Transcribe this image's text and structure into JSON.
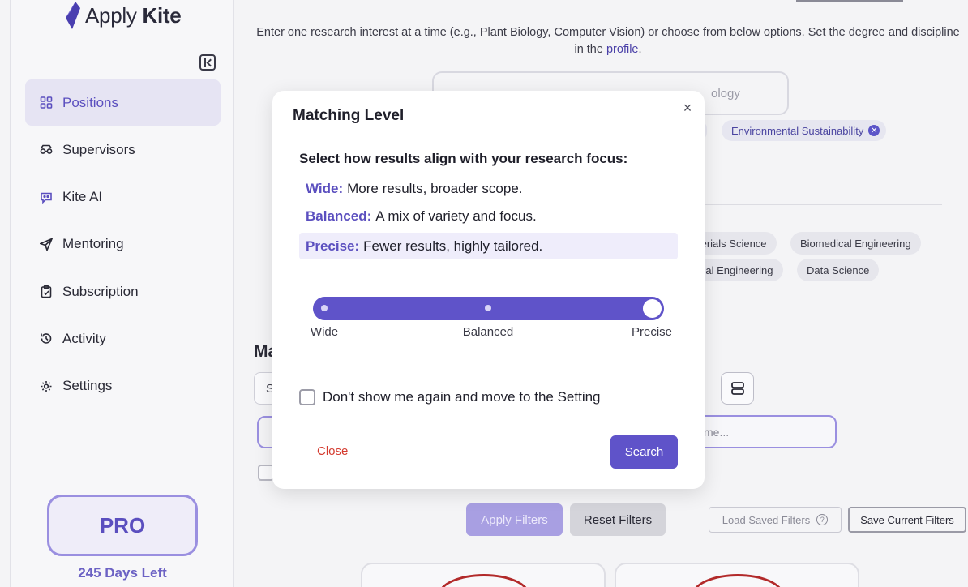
{
  "app": {
    "logo_light": "Apply",
    "logo_bold": "Kite",
    "accent_color": "#5f53c9"
  },
  "sidebar": {
    "items": [
      {
        "label": "Positions",
        "icon": "grid-icon",
        "active": true
      },
      {
        "label": "Supervisors",
        "icon": "glasses-icon",
        "active": false
      },
      {
        "label": "Kite AI",
        "icon": "chat-bot-icon",
        "active": false
      },
      {
        "label": "Mentoring",
        "icon": "send-icon",
        "active": false
      },
      {
        "label": "Subscription",
        "icon": "clipboard-icon",
        "active": false
      },
      {
        "label": "Activity",
        "icon": "history-icon",
        "active": false
      },
      {
        "label": "Settings",
        "icon": "gear-icon",
        "active": false
      }
    ],
    "plan": "PRO",
    "days_left": "245 Days Left"
  },
  "main": {
    "intro_text": "Enter one research interest at a time (e.g., Plant Biology, Computer Vision) or choose from below options. Set the degree and discipline in the",
    "intro_link": "profile",
    "intro_end": ".",
    "search_placeholder_visible": "ology",
    "selected_chips": [
      "Environmental Sustainability"
    ],
    "suggested_tags": [
      "terials Science",
      "Biomedical Engineering",
      "ical Engineering",
      "Data Science"
    ],
    "section_title_visible": "Ma",
    "select_visible": "S",
    "name_input_placeholder_visible": "me...",
    "apply_filters": "Apply Filters",
    "reset_filters": "Reset Filters",
    "load_saved_filters": "Load Saved Filters",
    "help_glyph": "?",
    "save_current_filters": "Save Current Filters"
  },
  "modal": {
    "title": "Matching Level",
    "close_glyph": "×",
    "subtitle": "Select how results align with your research focus:",
    "options": [
      {
        "key": "Wide:",
        "desc": "More results, broader scope.",
        "selected": false
      },
      {
        "key": "Balanced:",
        "desc": "A mix of variety and focus.",
        "selected": false
      },
      {
        "key": "Precise:",
        "desc": "Fewer results, highly tailored.",
        "selected": true
      }
    ],
    "slider": {
      "stops": [
        "Wide",
        "Balanced",
        "Precise"
      ],
      "value": "Precise"
    },
    "dont_show": "Don't show me again and move to the Setting",
    "dont_show_checked": false,
    "cancel_label": "Close",
    "search_label": "Search"
  }
}
